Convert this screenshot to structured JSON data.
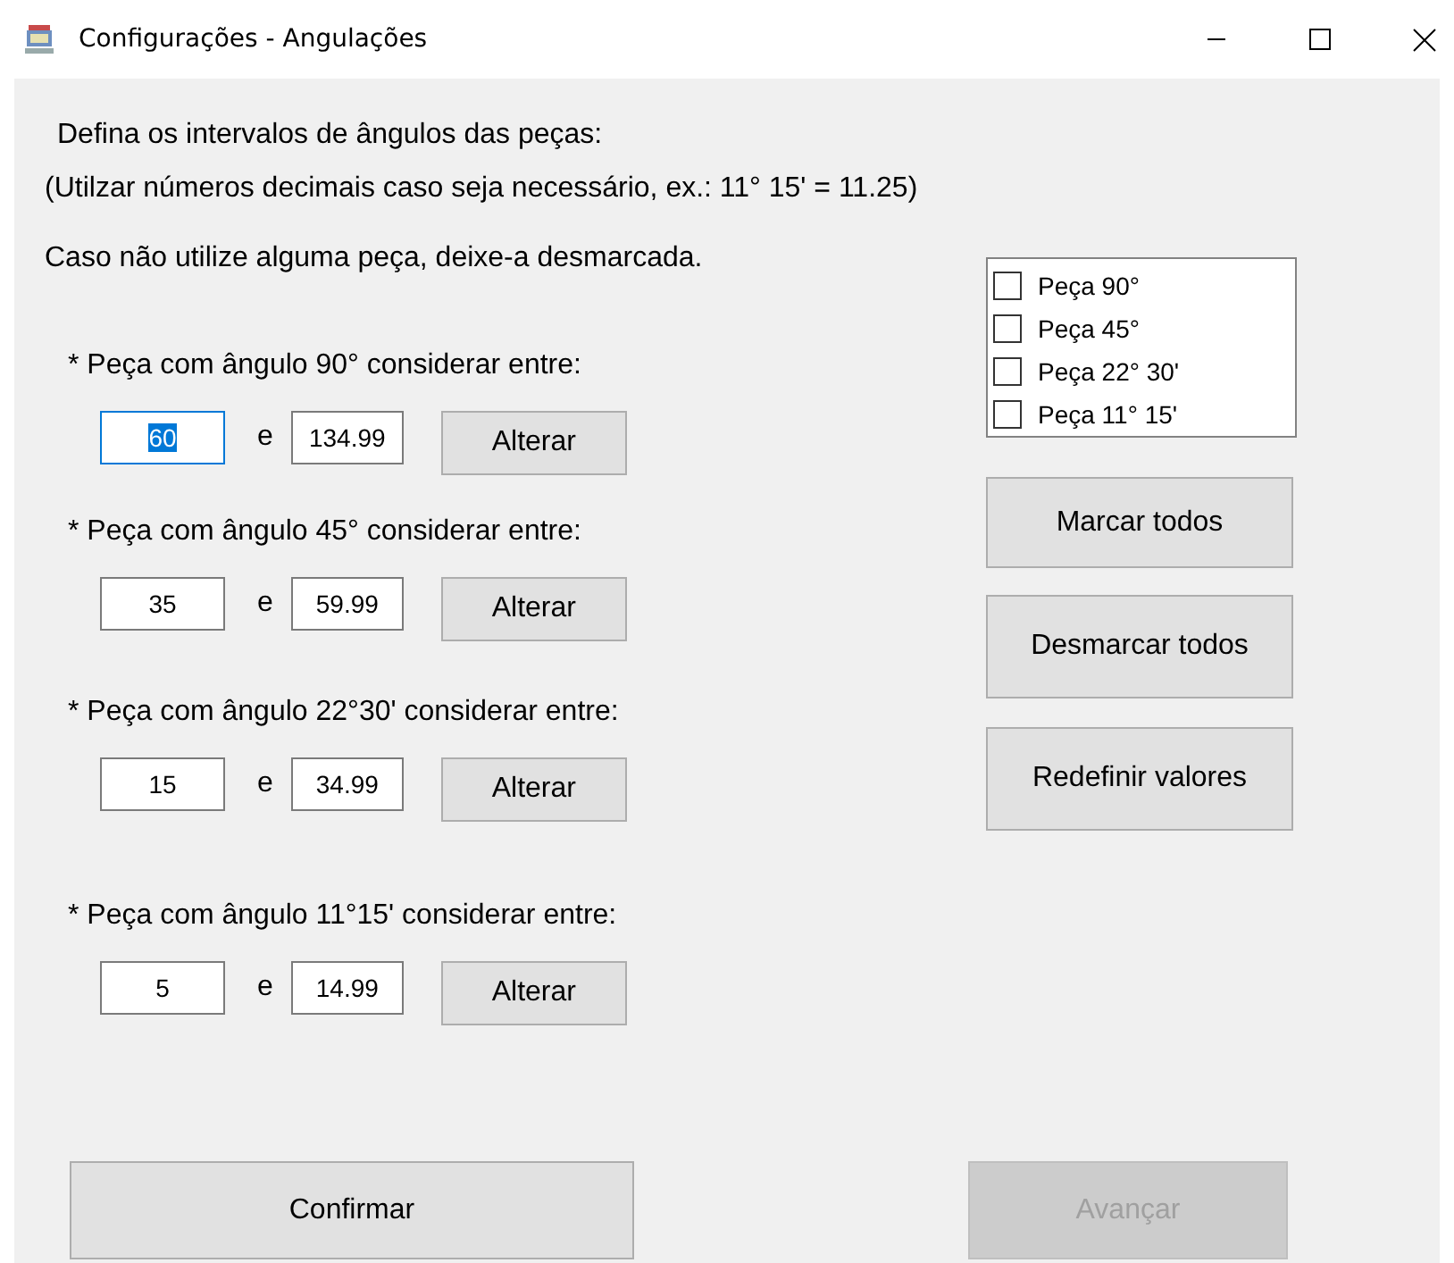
{
  "window": {
    "title": "Configurações - Angulações"
  },
  "intro": [
    "Defina os intervalos de ângulos das peças:",
    "(Utilzar números decimais caso seja necessário, ex.: 11° 15' = 11.25)",
    "Caso não utilize alguma peça, deixe-a desmarcada."
  ],
  "sections": [
    {
      "label": "* Peça com ângulo 90° considerar entre:",
      "min": "60",
      "min_focused": true,
      "separator": "e",
      "max": "134.99",
      "button": "Alterar"
    },
    {
      "label": "* Peça com ângulo 45° considerar entre:",
      "min": "35",
      "min_focused": false,
      "separator": "e",
      "max": "59.99",
      "button": "Alterar"
    },
    {
      "label": "* Peça com ângulo 22°30' considerar entre:",
      "min": "15",
      "min_focused": false,
      "separator": "e",
      "max": "34.99",
      "button": "Alterar"
    },
    {
      "label": "* Peça com ângulo 11°15' considerar entre:",
      "min": "5",
      "min_focused": false,
      "separator": "e",
      "max": "14.99",
      "button": "Alterar"
    }
  ],
  "checklist": [
    {
      "label": "Peça 90°",
      "checked": false
    },
    {
      "label": "Peça 45°",
      "checked": false
    },
    {
      "label": "Peça 22° 30'",
      "checked": false
    },
    {
      "label": "Peça 11° 15'",
      "checked": false
    }
  ],
  "side_buttons": [
    "Marcar todos",
    "Desmarcar todos",
    "Redefinir valores"
  ],
  "footer_buttons": [
    {
      "label": "Confirmar",
      "disabled": false
    },
    {
      "label": "Avançar",
      "disabled": true
    }
  ]
}
